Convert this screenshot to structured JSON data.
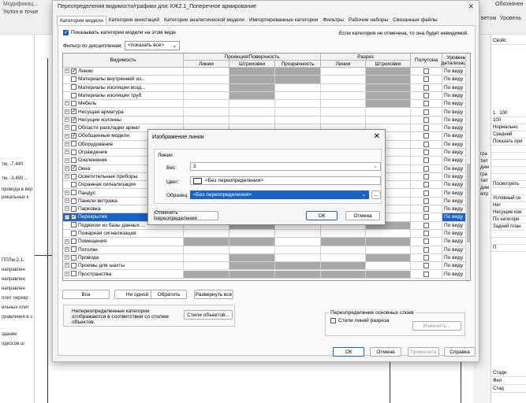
{
  "app": {
    "top_left_1": "Модификац...",
    "top_left_2": "Уклон  в точке",
    "top_right_1": "Обозначен",
    "top_right_2": "Уровень",
    "top_right_3": "ветом",
    "left_lines": [
      "тм. -7,440",
      "тм. -3,490 ...",
      "провода в вер",
      "рикальных к",
      "ППЛм-2.1-",
      "направлен",
      "направлен",
      "направлен",
      "плит перекр",
      "ельных плит",
      "правления в з",
      "здание",
      "одкосов ш"
    ],
    "right_cells": [
      "1 : 100",
      "100",
      "Нормально",
      "Средний",
      "Показать ори",
      "",
      "",
      "",
      "",
      "",
      "Посмотреть",
      "",
      "Условный се",
      "Нет",
      "Несущие кон",
      "По категори",
      "Задний план",
      "",
      "",
      "П"
    ],
    "right_side_labels": [
      "гра",
      "ти/г",
      "дим",
      "гра",
      "ти/г",
      "дим",
      "я/гр"
    ],
    "right_top": "Свойс",
    "right_bottom": [
      "Стади",
      "Фил",
      "Стад"
    ]
  },
  "dialog": {
    "title": "Переопределения видимости/графики для: КЖ2.1_Поперечное армирование",
    "tabs": [
      "Категории модели",
      "Категории аннотаций",
      "Категории аналитической модели",
      "Импортированные категории",
      "Фильтры",
      "Рабочие наборы",
      "Связанные файлы"
    ],
    "show_all_label": "Показывать категории модели на этом виде",
    "note": "Если категория не отмечена, то она будет невидимой.",
    "filter_label": "Фильтр по дисциплинам:",
    "filter_value": "<показать все>",
    "headers": {
      "visibility": "Видимость",
      "projection": "Проекция/Поверхность",
      "lines": "Линии",
      "hatch": "Штриховки",
      "transparency": "Прозрачность",
      "section": "Разрез",
      "sec_lines": "Линии",
      "sec_hatch": "Штриховки",
      "halftone": "Полутона",
      "detail": "Уровень детализации"
    },
    "rows": [
      {
        "name": "Линии",
        "exp": true,
        "checked": true,
        "gray": [
          2,
          3,
          5,
          6
        ],
        "detail": "По виду"
      },
      {
        "name": "Материалы внутренней из...",
        "exp": false,
        "checked": false,
        "gray": [
          2,
          3,
          5,
          6
        ],
        "detail": "По виду"
      },
      {
        "name": "Материалы изоляции возд...",
        "exp": false,
        "checked": false,
        "gray": [
          2,
          5,
          6
        ],
        "detail": "По виду"
      },
      {
        "name": "Материалы изоляции труб",
        "exp": false,
        "checked": false,
        "gray": [
          2,
          5,
          6
        ],
        "detail": "По виду"
      },
      {
        "name": "Мебель",
        "exp": true,
        "checked": false,
        "gray": [
          5,
          6
        ],
        "detail": "По виду"
      },
      {
        "name": "Несущая арматура",
        "exp": true,
        "checked": true,
        "gray": [],
        "detail": "По виду"
      },
      {
        "name": "Несущие колонны",
        "exp": true,
        "checked": true,
        "gray": [],
        "detail": "По виду"
      },
      {
        "name": "Области раскладки армат",
        "exp": true,
        "checked": false,
        "gray": [],
        "detail": "По виду"
      },
      {
        "name": "Обобщенные модели",
        "exp": true,
        "checked": true,
        "gray": [],
        "detail": "По виду"
      },
      {
        "name": "Оборудование",
        "exp": true,
        "checked": false,
        "gray": [],
        "detail": "По виду"
      },
      {
        "name": "Ограждение",
        "exp": true,
        "checked": false,
        "gray": [],
        "detail": "По виду"
      },
      {
        "name": "Озеленение",
        "exp": true,
        "checked": false,
        "gray": [],
        "detail": "По виду"
      },
      {
        "name": "Окна",
        "exp": true,
        "checked": true,
        "gray": [],
        "detail": "По виду"
      },
      {
        "name": "Осветительные приборы",
        "exp": true,
        "checked": false,
        "gray": [],
        "detail": "По виду"
      },
      {
        "name": "Охранная сигнализация",
        "exp": false,
        "checked": false,
        "gray": [],
        "detail": "По виду"
      },
      {
        "name": "Пандус",
        "exp": true,
        "checked": false,
        "gray": [],
        "detail": "По виду"
      },
      {
        "name": "Панели витража",
        "exp": true,
        "checked": false,
        "gray": [],
        "detail": "По виду"
      },
      {
        "name": "Парковка",
        "exp": true,
        "checked": false,
        "gray": [],
        "detail": "По виду"
      },
      {
        "name": "Перекрытия",
        "exp": true,
        "checked": true,
        "gray": [],
        "detail": "По виду",
        "selected": true
      },
      {
        "name": "Подвески из базы данных ...",
        "exp": false,
        "checked": false,
        "gray": [
          2,
          5,
          6
        ],
        "detail": "По виду"
      },
      {
        "name": "Пожарная сигнализация",
        "exp": false,
        "checked": false,
        "gray": [],
        "detail": "По виду"
      },
      {
        "name": "Помещения",
        "exp": true,
        "checked": false,
        "gray": [
          1,
          2,
          4,
          5
        ],
        "detail": "По виду"
      },
      {
        "name": "Потолки",
        "exp": true,
        "checked": false,
        "gray": [],
        "detail": "По виду"
      },
      {
        "name": "Провода",
        "exp": true,
        "checked": false,
        "gray": [
          2,
          5,
          6
        ],
        "detail": "По виду"
      },
      {
        "name": "Проемы для шахты",
        "exp": true,
        "checked": false,
        "gray": [
          2,
          3,
          4,
          6
        ],
        "detail": "По виду"
      },
      {
        "name": "Пространства",
        "exp": true,
        "checked": false,
        "gray": [
          1,
          2,
          3,
          4,
          5,
          6
        ],
        "detail": "По виду"
      }
    ],
    "buttons": {
      "all": "Все",
      "none": "Ни одной",
      "invert": "Обратить",
      "expand": "Развернуть все",
      "styles": "Стили объектов...",
      "edit": "Изменить...",
      "ok": "ОК",
      "cancel": "Отмена",
      "apply": "Применить",
      "help": "Справка"
    },
    "legend_text": "Непереопределенные категории отображаются в соответствии со стилем объектов.",
    "override_group": "Переопределение основных слоев",
    "override_option": "Стили линий разреза"
  },
  "line_dialog": {
    "title": "Изображение линии",
    "group": "Линии",
    "weight_label": "Вес:",
    "weight_value": "3",
    "color_label": "Цвет:",
    "color_value": "<Без переопределения>",
    "pattern_label": "Образец:",
    "pattern_value": "<Без переопределения>",
    "more": "...",
    "reset": "Отменить переопределения",
    "ok": "ОК",
    "cancel": "Отмена"
  }
}
